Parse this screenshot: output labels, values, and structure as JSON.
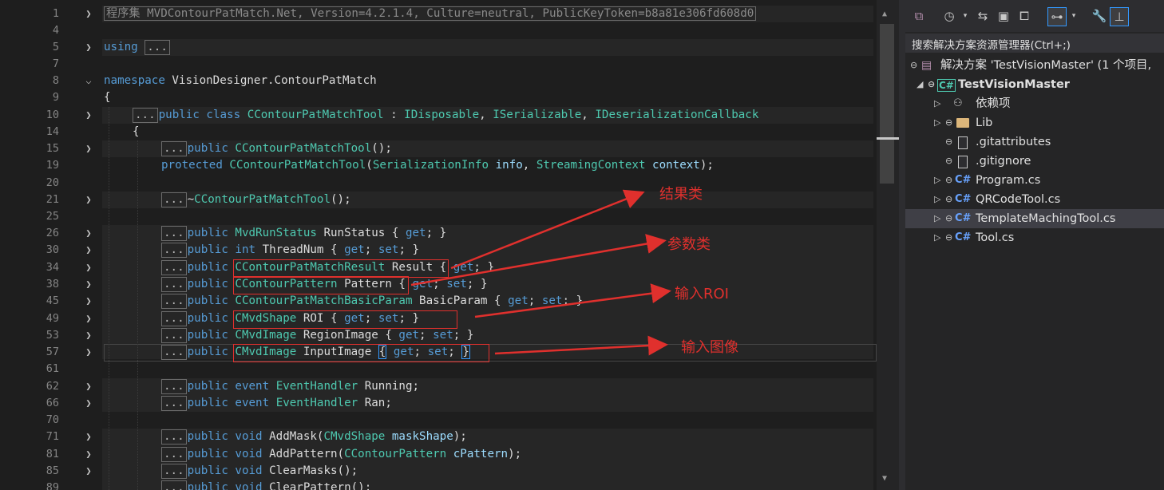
{
  "editor": {
    "line_numbers": [
      "1",
      "4",
      "5",
      "7",
      "8",
      "9",
      "10",
      "14",
      "15",
      "19",
      "20",
      "21",
      "25",
      "26",
      "30",
      "34",
      "38",
      "45",
      "49",
      "53",
      "57",
      "61",
      "62",
      "66",
      "70",
      "71",
      "81",
      "85",
      "89"
    ],
    "assembly_text": "程序集 MVDContourPatMatch.Net, Version=4.2.1.4, Culture=neutral, PublicKeyToken=b8a81e306fd608d0",
    "collapsed_marker": "...",
    "using_kw": "using",
    "namespace_kw": "namespace",
    "namespace_name": "VisionDesigner.ContourPatMatch",
    "open_brace": "{",
    "lines": {
      "class_decl": {
        "public": "public",
        "class": "class",
        "name": "CContourPatMatchTool",
        "rest": " : ",
        "i1": "IDisposable",
        "sep1": ", ",
        "i2": "ISerializable",
        "sep2": ", ",
        "i3": "IDeserializationCallback"
      },
      "ctor1": {
        "public": "public",
        "name": "CContourPatMatchTool",
        "rest": "();"
      },
      "ctor2": {
        "protected": "protected",
        "name": "CContourPatMatchTool",
        "p1": "(",
        "t1": "SerializationInfo",
        "a1": " info",
        "p2": ", ",
        "t2": "StreamingContext",
        "a2": " context",
        "p3": ");"
      },
      "dtor": {
        "tilde": "~",
        "name": "CContourPatMatchTool",
        "rest": "();"
      },
      "runstatus": {
        "public": "public",
        "type": "MvdRunStatus",
        "name": " RunStatus { ",
        "get": "get",
        "end": "; }"
      },
      "threadnum": {
        "public": "public",
        "type": "int",
        "name": " ThreadNum { ",
        "get": "get",
        "mid": "; ",
        "set": "set",
        "end": "; }"
      },
      "result": {
        "public": "public",
        "type": "CContourPatMatchResult",
        "name": " Result",
        "open": " { ",
        "get": "get",
        "end": "; }"
      },
      "pattern": {
        "public": "public",
        "type": "CContourPattern",
        "name": " Pattern",
        "open": " { ",
        "get": "get",
        "mid": "; ",
        "set": "set",
        "end": "; }"
      },
      "basicparam": {
        "public": "public",
        "type": "CContourPatMatchBasicParam",
        "name": " BasicParam { ",
        "get": "get",
        "mid": "; ",
        "set": "set",
        "end": "; }"
      },
      "roi": {
        "public": "public",
        "type": "CMvdShape",
        "name": " ROI { ",
        "get": "get",
        "mid": "; ",
        "set": "set",
        "end": "; }"
      },
      "regionimage": {
        "public": "public",
        "type": "CMvdImage",
        "name": " RegionImage { ",
        "get": "get",
        "mid": "; ",
        "set": "set",
        "end": "; }"
      },
      "inputimage": {
        "public": "public",
        "type": "CMvdImage",
        "name": " InputImage ",
        "open": "{",
        "sp": " ",
        "get": "get",
        "mid": "; ",
        "set": "set",
        "semi": "; ",
        "close": "}"
      },
      "running": {
        "public": "public",
        "event": "event",
        "type": "EventHandler",
        "name": " Running;"
      },
      "ran": {
        "public": "public",
        "event": "event",
        "type": "EventHandler",
        "name": " Ran;"
      },
      "addmask": {
        "public": "public",
        "void": "void",
        "name": " AddMask(",
        "type": "CMvdShape",
        "arg": " maskShape",
        "end": ");"
      },
      "addpattern": {
        "public": "public",
        "void": "void",
        "name": " AddPattern(",
        "type": "CContourPattern",
        "arg": " cPattern",
        "end": ");"
      },
      "clearmasks": {
        "public": "public",
        "void": "void",
        "name": " ClearMasks();"
      },
      "clearpattern": {
        "public": "public",
        "void": "void",
        "name": " ClearPattern();"
      }
    }
  },
  "annotations": {
    "result_label": "结果类",
    "param_label": "参数类",
    "roi_label": "输入ROI",
    "image_label": "输入图像",
    "color": "#e0302d"
  },
  "solution_explorer": {
    "search_placeholder": "搜索解决方案资源管理器(Ctrl+;)",
    "solution_label": "解决方案 'TestVisionMaster' (1 个项目,",
    "project_label": "TestVisionMaster",
    "items": [
      {
        "label": "依赖项",
        "icon": "dependencies-icon"
      },
      {
        "label": "Lib",
        "icon": "folder-icon"
      },
      {
        "label": ".gitattributes",
        "icon": "file-icon"
      },
      {
        "label": ".gitignore",
        "icon": "file-icon"
      },
      {
        "label": "Program.cs",
        "icon": "csharp-icon"
      },
      {
        "label": "QRCodeTool.cs",
        "icon": "csharp-icon"
      },
      {
        "label": "TemplateMachingTool.cs",
        "icon": "csharp-icon"
      },
      {
        "label": "Tool.cs",
        "icon": "csharp-icon"
      }
    ],
    "cs_glyph": "C#",
    "proj_glyph": "C#"
  },
  "colors": {
    "background": "#1e1e1e",
    "keyword": "#569cd6",
    "type": "#4ec9b0",
    "sidebar": "#252526",
    "selected": "#3f3f46"
  }
}
